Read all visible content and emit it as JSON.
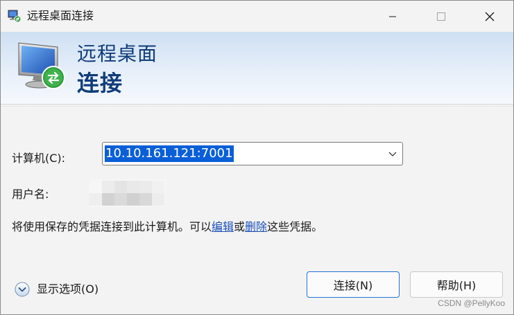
{
  "window": {
    "title": "远程桌面连接",
    "icon": "remote-desktop-icon",
    "controls": {
      "minimize": "minimize-icon",
      "maximize": "maximize-icon",
      "close": "close-icon"
    }
  },
  "banner": {
    "line1": "远程桌面",
    "line2": "连接",
    "icon": "remote-desktop-monitor-icon"
  },
  "form": {
    "computer_label": "计算机(C):",
    "computer_value": "10.10.161.121:7001",
    "user_label": "用户名:"
  },
  "info": {
    "prefix": "将使用保存的凭据连接到此计算机。可以",
    "edit_link": "编辑",
    "middle": "或",
    "delete_link": "删除",
    "suffix": "这些凭据。"
  },
  "options": {
    "label": "显示选项(O)",
    "icon": "chevron-down-icon"
  },
  "buttons": {
    "connect": "连接(N)",
    "help": "帮助(H)"
  },
  "watermark": "CSDN @PellyKoo",
  "colors": {
    "accent": "#1f6fd0",
    "banner_text": "#103c7a",
    "link": "#1a4fb8",
    "selection": "#0a5fd6"
  }
}
